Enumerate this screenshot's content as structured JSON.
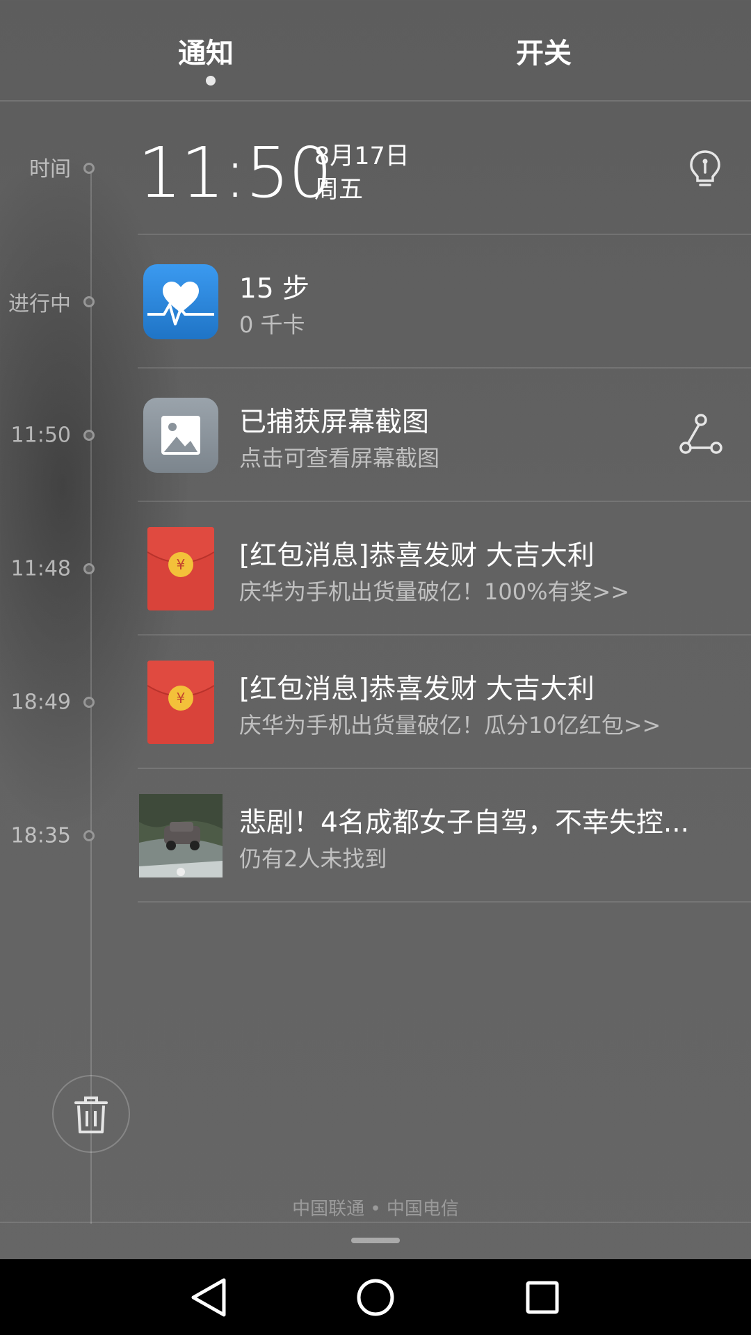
{
  "tabs": [
    {
      "label": "通知",
      "selected": true
    },
    {
      "label": "开关",
      "selected": false
    }
  ],
  "timeline": {
    "header_label": "时间",
    "clock": {
      "time": "11:50",
      "date": "8月17日",
      "weekday": "周五",
      "icon": "lightbulb-icon"
    }
  },
  "notifications": [
    {
      "time_label": "进行中",
      "icon": "health-heart-icon",
      "title": "15 步",
      "subtitle": "0 千卡"
    },
    {
      "time_label": "11:50",
      "icon": "gallery-icon",
      "title": "已捕获屏幕截图",
      "subtitle": "点击可查看屏幕截图",
      "action_icon": "share-icon"
    },
    {
      "time_label": "11:48",
      "icon": "red-envelope-icon",
      "title": "[红包消息]恭喜发财 大吉大利",
      "subtitle": "庆华为手机出货量破亿！100%有奖>>"
    },
    {
      "time_label": "18:49",
      "icon": "red-envelope-icon",
      "title": "[红包消息]恭喜发财 大吉大利",
      "subtitle": "庆华为手机出货量破亿！瓜分10亿红包>>"
    },
    {
      "time_label": "18:35",
      "icon": "news-thumbnail",
      "title": "悲剧！4名成都女子自驾，不幸失控...",
      "subtitle": "仍有2人未找到"
    }
  ],
  "carrier_text": "中国联通 • 中国电信",
  "colors": {
    "envelope_red": "#d9433a",
    "coin_gold": "#f3c13a",
    "health_blue": "#2b86d9",
    "nav_bar": "#000000"
  }
}
